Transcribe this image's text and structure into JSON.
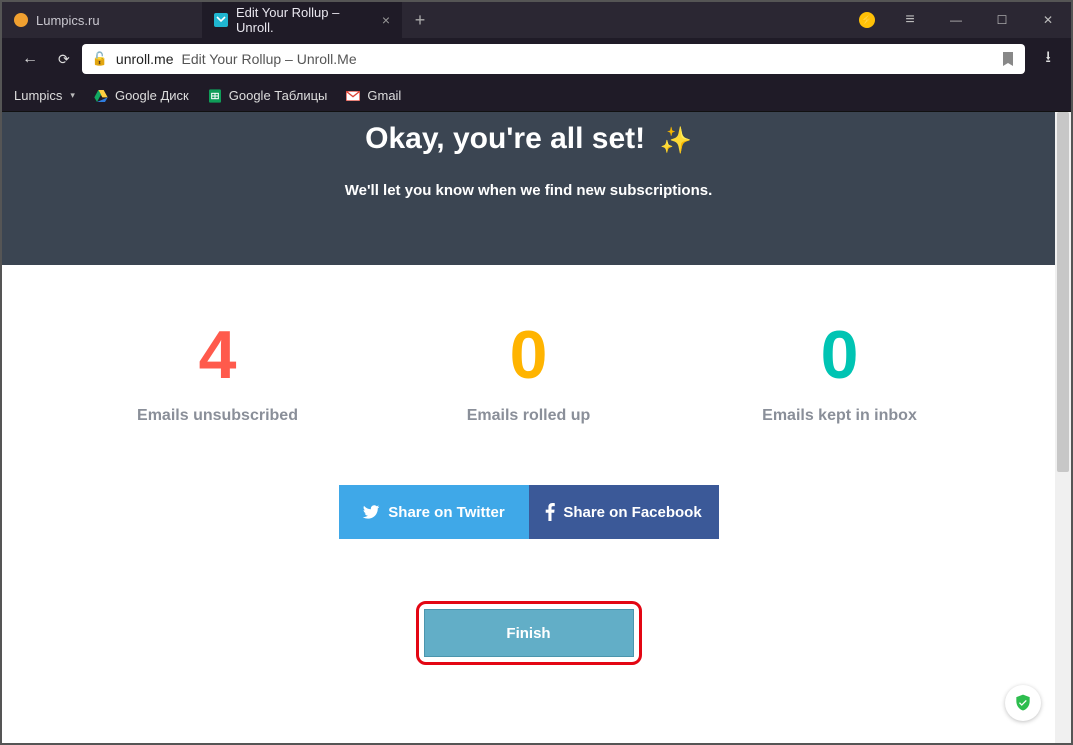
{
  "tabs": [
    {
      "label": "Lumpics.ru"
    },
    {
      "label": "Edit Your Rollup – Unroll."
    }
  ],
  "address": {
    "domain": "unroll.me",
    "title": "Edit Your Rollup – Unroll.Me"
  },
  "bookmarks": {
    "b0": "Lumpics",
    "b1": "Google Диск",
    "b2": "Google Таблицы",
    "b3": "Gmail"
  },
  "hero": {
    "title": "Okay, you're all set!",
    "subtitle": "We'll let you know when we find new subscriptions."
  },
  "stats": [
    {
      "value": "4",
      "label": "Emails unsubscribed"
    },
    {
      "value": "0",
      "label": "Emails rolled up"
    },
    {
      "value": "0",
      "label": "Emails kept in inbox"
    }
  ],
  "share": {
    "twitter": "Share on Twitter",
    "facebook": "Share on Facebook"
  },
  "finish": {
    "label": "Finish"
  }
}
